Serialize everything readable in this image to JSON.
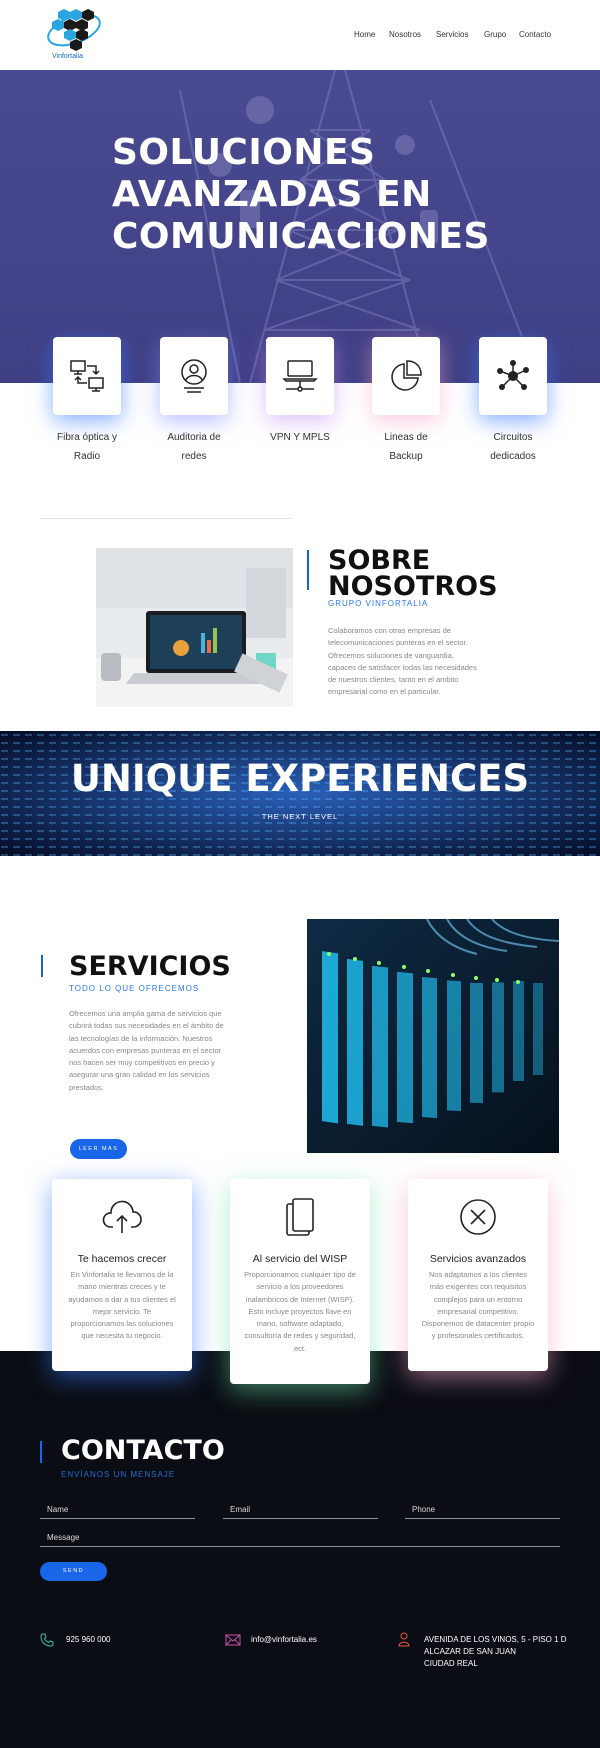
{
  "header": {
    "logo_text": "Vinfortalia",
    "nav": [
      "Home",
      "Nosotros",
      "Servicios",
      "Grupo",
      "Contacto"
    ]
  },
  "hero": {
    "title_lines": [
      "SOLUCIONES",
      "AVANZADAS EN",
      "COMUNICACIONES"
    ]
  },
  "features": [
    {
      "icon": "network-icon",
      "label_lines": [
        "Fibra óptica y",
        "Radio"
      ],
      "glow": "#3a7bff"
    },
    {
      "icon": "user-circle-icon",
      "label_lines": [
        "Auditoria de",
        "redes"
      ],
      "glow": "#7a8dff"
    },
    {
      "icon": "laptop-network-icon",
      "label_lines": [
        "VPN Y MPLS"
      ],
      "glow": "#c38cf0"
    },
    {
      "icon": "pie-chart-icon",
      "label_lines": [
        "Lineas de",
        "Backup"
      ],
      "glow": "#f4a3c8"
    },
    {
      "icon": "hub-icon",
      "label_lines": [
        "Circuitos",
        "dedicados"
      ],
      "glow": "#3a7bff"
    }
  ],
  "about": {
    "title_lines": [
      "SOBRE",
      "NOSOTROS"
    ],
    "subtitle": "GRUPO VINFORTALIA",
    "text": "Colaboramos con otras empresas de telecomunicaciones punteras en el sector. Ofrecemos soluciones de vanguardia, capaces de satisfacer todas las necesidades de nuestros clientes, tanto en el ambito empresarial como en el particular."
  },
  "banner": {
    "title": "UNIQUE EXPERIENCES",
    "subtitle": "THE NEXT LEVEL"
  },
  "services": {
    "title": "SERVICIOS",
    "subtitle": "TODO LO QUE OFRECEMOS",
    "text": "Ofrecemos una amplia gama de servicios que cubrirá todas sus necesidades en el ámbito de las tecnologías de la información. Nuestros acuerdos con empresas punteras en el sector nos hacen ser muy competitivos en precio y asegurar una gran calidad en los servicios prestados.",
    "button": "LEER MÁS",
    "cards": [
      {
        "icon": "cloud-upload-icon",
        "title": "Te hacemos crecer",
        "text": "En Vinfortalia te llevamos de la mano mientras creces y te ayudamos a dar a tus clientes el mejor servicio. Te proporcionamos las soluciones que necesita tu negocio.",
        "glow": "#3a7bff"
      },
      {
        "icon": "devices-icon",
        "title": "Al servicio del WISP",
        "text": "Proporcionamos cualquier tipo de servicio a los proveedores inalambricos de Internet (WISP). Esto incluye proyectos llave en mano, software adaptado, consultoría de redes y seguridad, ect.",
        "glow": "#6fe3a8"
      },
      {
        "icon": "close-circle-icon",
        "title": "Servicios avanzados",
        "text": "Nos adaptamos a los clientes más exigentes con requisitos complejos para un entorno empresarial competitivo. Disponemos de datacenter propio y profesionales certificados.",
        "glow": "#f4a3c8"
      }
    ]
  },
  "contact": {
    "title": "CONTACTO",
    "subtitle": "ENVÍANOS UN MENSAJE",
    "fields": {
      "name": "Name",
      "email": "Email",
      "phone": "Phone",
      "message": "Message"
    },
    "button": "SEND",
    "phone": "925 960 000",
    "email": "info@vinfortalia.es",
    "address_lines": [
      "AVENIDA DE LOS VINOS, 5 - PISO 1 D",
      "ALCAZAR DE SAN JUAN",
      "CIUDAD REAL"
    ],
    "phone_color": "#3fc3a8",
    "email_color": "#d04fb0",
    "address_color": "#e8563f"
  }
}
